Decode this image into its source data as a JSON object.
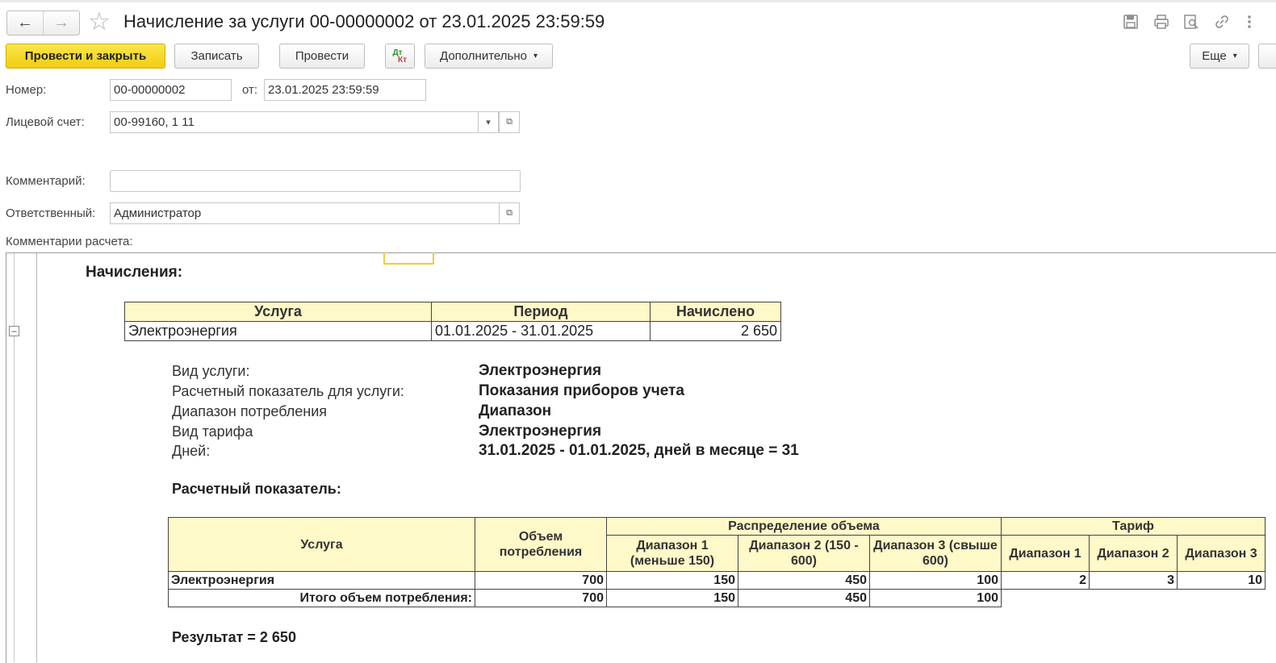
{
  "window": {
    "title": "Начисление за услуги 00-00000002 от 23.01.2025 23:59:59",
    "nav_back": "←",
    "nav_forward": "→",
    "favorite_icon": "star-icon",
    "tool_icons": [
      "save-icon",
      "print-icon",
      "preview-icon",
      "link-icon",
      "more-vertical-icon"
    ]
  },
  "toolbar": {
    "post_and_close": "Провести и закрыть",
    "save": "Записать",
    "post": "Провести",
    "dt": "Дт",
    "kt": "Кт",
    "more": "Дополнительно",
    "more_caret": "▾",
    "extra": "Еще",
    "extra_caret": "▾"
  },
  "form": {
    "number_label": "Номер:",
    "number_value": "00-00000002",
    "date_label": "от:",
    "date_value": "23.01.2025 23:59:59",
    "account_label": "Лицевой счет:",
    "account_value": "00-99160, 1 11",
    "comment_label": "Комментарий:",
    "comment_value": "",
    "responsible_label": "Ответственный:",
    "responsible_value": "Администратор",
    "calc_comments_label": "Комментарии расчета:"
  },
  "report": {
    "heading": "Начисления:",
    "charges_table": {
      "headers": [
        "Услуга",
        "Период",
        "Начислено"
      ],
      "rows": [
        [
          "Электроэнергия",
          "01.01.2025 - 31.01.2025",
          "2 650"
        ]
      ]
    },
    "details": [
      {
        "key": "Вид услуги:",
        "value": "Электроэнергия"
      },
      {
        "key": "Расчетный показатель для услуги:",
        "value": "Показания приборов учета"
      },
      {
        "key": "Диапазон потребления",
        "value": "Диапазон"
      },
      {
        "key": "Вид тарифа",
        "value": "Электроэнергия"
      },
      {
        "key": "Дней:",
        "value": "31.01.2025 - 01.01.2025, дней в месяце = 31"
      }
    ],
    "indicator_heading": "Расчетный показатель:",
    "indicator_table": {
      "h_service": "Услуга",
      "h_volume": "Объем потребления",
      "h_distribution": "Распределение объема",
      "h_tariff": "Тариф",
      "h_range1": "Диапазон 1 (меньше 150)",
      "h_range2": "Диапазон 2 (150 - 600)",
      "h_range3": "Диапазон 3 (свыше 600)",
      "h_t_range1": "Диапазон 1",
      "h_t_range2": "Диапазон 2",
      "h_t_range3": "Диапазон 3",
      "row": {
        "service": "Электроэнергия",
        "volume": "700",
        "r1": "150",
        "r2": "450",
        "r3": "100",
        "t1": "2",
        "t2": "3",
        "t3": "10"
      },
      "total": {
        "label": "Итого объем потребления:",
        "volume": "700",
        "r1": "150",
        "r2": "450",
        "r3": "100"
      }
    },
    "result": "Результат = 2 650"
  }
}
